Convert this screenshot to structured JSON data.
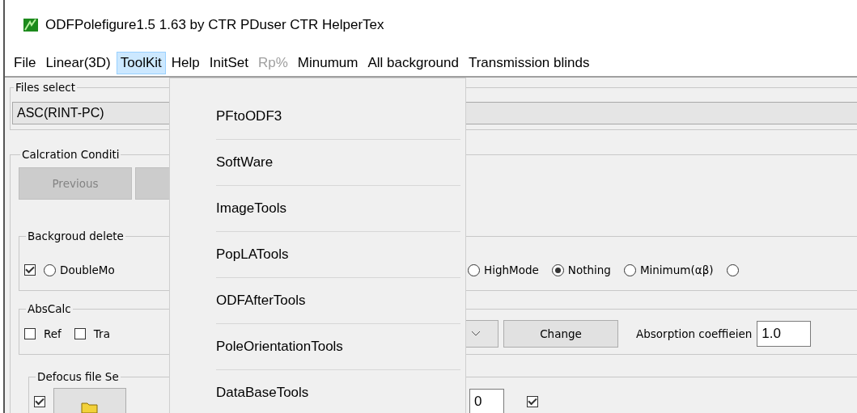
{
  "window": {
    "title": "ODFPolefigure1.5 1.63 by CTR PDuser CTR HelperTex"
  },
  "menu_bar": [
    {
      "label": "File",
      "selected": false,
      "disabled": false
    },
    {
      "label": "Linear(3D)",
      "selected": false,
      "disabled": false
    },
    {
      "label": "ToolKit",
      "selected": true,
      "disabled": false
    },
    {
      "label": "Help",
      "selected": false,
      "disabled": false
    },
    {
      "label": "InitSet",
      "selected": false,
      "disabled": false
    },
    {
      "label": "Rp%",
      "selected": false,
      "disabled": true
    },
    {
      "label": "Minumum",
      "selected": false,
      "disabled": false
    },
    {
      "label": "All background",
      "selected": false,
      "disabled": false
    },
    {
      "label": "Transmission blinds",
      "selected": false,
      "disabled": false
    }
  ],
  "toolkit_menu": {
    "items": [
      "PFtoODF3",
      "SoftWare",
      "ImageTools",
      "PopLATools",
      "ODFAfterTools",
      "PoleOrientationTools",
      "DataBaseTools"
    ]
  },
  "files_select": {
    "title": "Files select",
    "value": "ASC(RINT-PC)"
  },
  "calc_conditions": {
    "title": "Calcration Conditi",
    "buttons": [
      {
        "label": "Previous",
        "disabled": true
      },
      {
        "disabled": true
      }
    ]
  },
  "background_delete": {
    "title": "Backgroud delete",
    "enabled": true,
    "options": [
      {
        "label": "DoubleMo",
        "selected": false
      },
      {
        "label": "HighMode",
        "selected": false
      },
      {
        "label": "Nothing",
        "selected": true
      },
      {
        "label": "Minimum(αβ)",
        "selected": false
      },
      {
        "selected": false
      }
    ]
  },
  "abs_calc": {
    "title": "AbsCalc",
    "checks": [
      {
        "label": "Ref",
        "checked": false
      },
      {
        "label": "Tra",
        "checked": false
      }
    ],
    "change_button": "Change",
    "coefficient_label": "Absorption coeffieien",
    "coefficient": "1.0"
  },
  "defocus": {
    "title": "Defocus file Se",
    "enabled": true,
    "count": "0",
    "fit_checked": true
  }
}
